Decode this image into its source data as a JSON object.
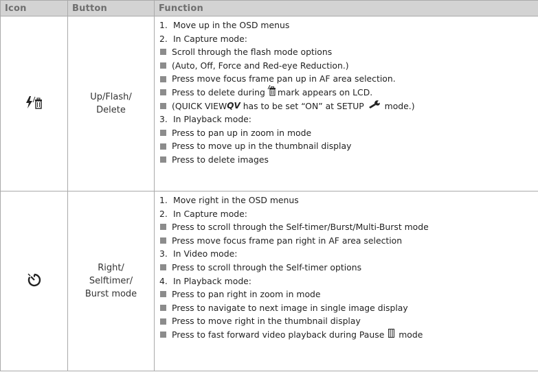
{
  "table": {
    "headers": [
      "Icon",
      "Button",
      "Function"
    ],
    "rows": [
      {
        "icon": "flash-delete-icon",
        "button_lines": [
          "Up/Flash/",
          "Delete"
        ],
        "functions": [
          {
            "marker": "1.",
            "text": "Move up in the OSD menus"
          },
          {
            "marker": "2.",
            "text": "In Capture mode:"
          },
          {
            "marker": "square",
            "text": "Scroll through the flash mode options"
          },
          {
            "marker": "square",
            "text": "(Auto, Off, Force and Red-eye Reduction.)"
          },
          {
            "marker": "square",
            "text": "Press move focus frame pan up in AF area selection."
          },
          {
            "marker": "square",
            "text_before": "Press to delete during ",
            "icon": "delete-mark-icon",
            "text_after": "mark appears on LCD."
          },
          {
            "marker": "square",
            "text_before": "(QUICK VIEW ",
            "icon_text": "QV",
            "text_middle": " has to be set “ON” at SETUP ",
            "icon": "wrench-icon",
            "text_after": " mode.)"
          },
          {
            "marker": "3.",
            "text": "In Playback mode:"
          },
          {
            "marker": "square",
            "text": "Press to pan up in zoom in mode"
          },
          {
            "marker": "square",
            "text": "Press to move up in the thumbnail display"
          },
          {
            "marker": "square",
            "text": "Press to delete images"
          }
        ]
      },
      {
        "icon": "selftimer-icon",
        "button_lines": [
          "Right/",
          "Selftimer/",
          "Burst mode"
        ],
        "functions": [
          {
            "marker": "1.",
            "text": "Move right in the OSD menus"
          },
          {
            "marker": "2.",
            "text": "In Capture mode:"
          },
          {
            "marker": "square",
            "text": "Press to scroll through the Self-timer/Burst/Multi-Burst mode"
          },
          {
            "marker": "square",
            "text": "Press move focus frame pan right in AF area selection"
          },
          {
            "marker": "3.",
            "text": "In Video mode:"
          },
          {
            "marker": "square",
            "text": "Press to scroll through the Self-timer options"
          },
          {
            "marker": "4.",
            "text": "In Playback mode:"
          },
          {
            "marker": "square",
            "text": "Press to pan right in zoom in mode"
          },
          {
            "marker": "square",
            "text": "Press to navigate to next image in single image display"
          },
          {
            "marker": "square",
            "text": "Press to move right in the thumbnail display"
          },
          {
            "marker": "square",
            "text_before": "Press to fast forward video playback during Pause ",
            "icon": "pause-icon",
            "text_after": " mode"
          }
        ]
      }
    ]
  }
}
